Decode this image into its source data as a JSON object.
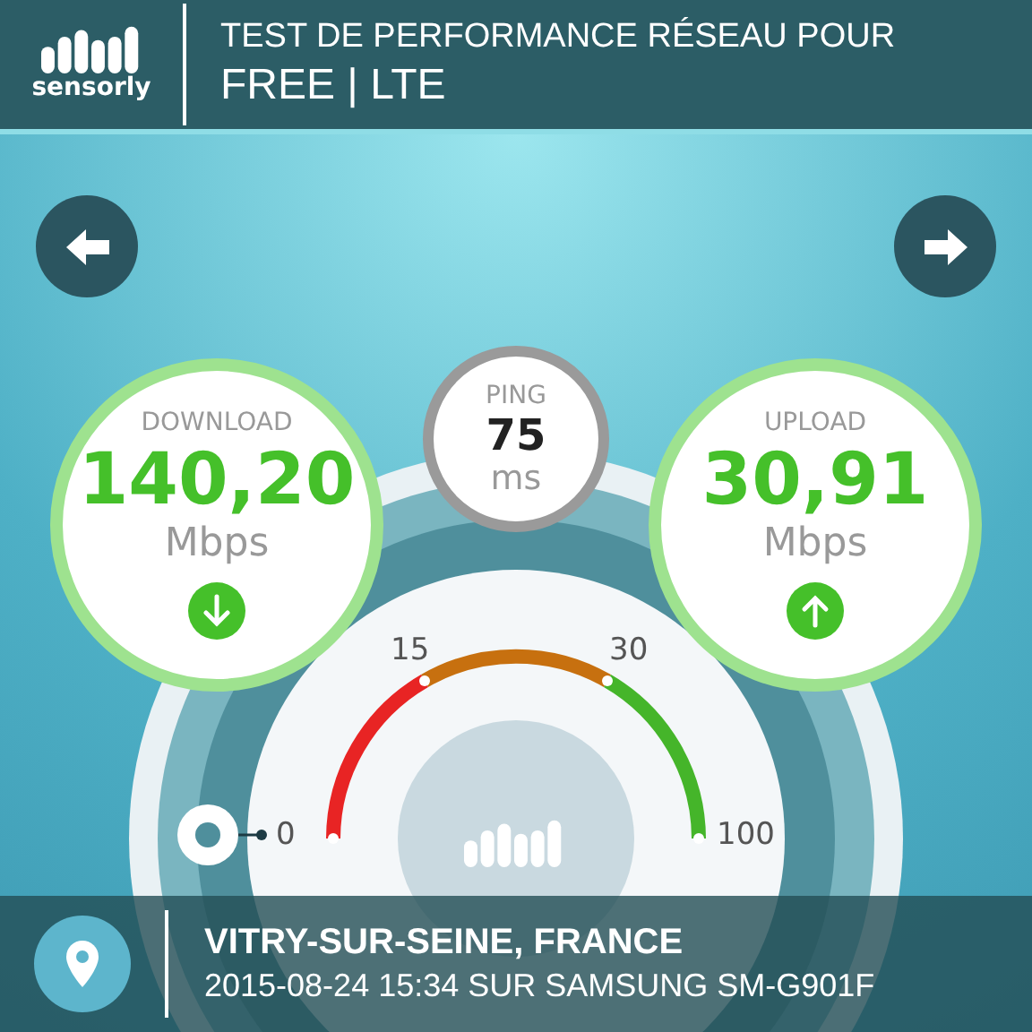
{
  "header": {
    "logo": "sensorly",
    "title": "TEST DE PERFORMANCE RÉSEAU POUR",
    "subtitle": "FREE | LTE"
  },
  "metrics": [
    {
      "kind": "download",
      "label": "DOWNLOAD",
      "value": "140,20",
      "unit": "Mbps"
    },
    {
      "kind": "ping",
      "label": "PING",
      "value": "75",
      "unit": "ms"
    },
    {
      "kind": "upload",
      "label": "UPLOAD",
      "value": "30,91",
      "unit": "Mbps"
    }
  ],
  "gauge": {
    "ticks": [
      "0",
      "15",
      "30",
      "100"
    ]
  },
  "location": {
    "place": "VITRY-SUR-SEINE, FRANCE",
    "details": "2015-08-24 15:34 SUR SAMSUNG SM-G901F"
  }
}
